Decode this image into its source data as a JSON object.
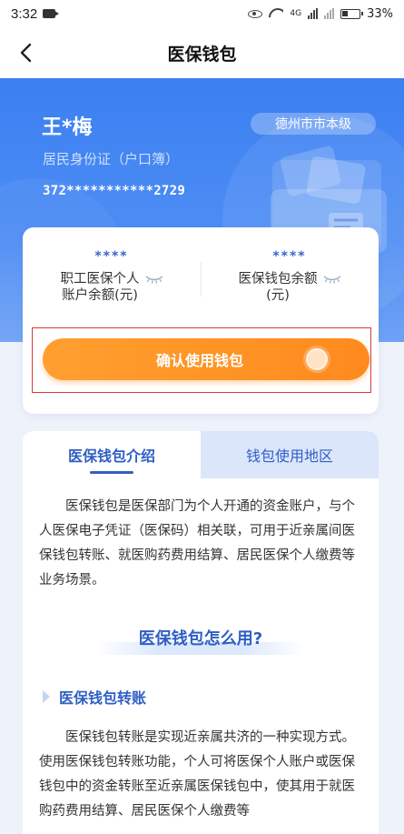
{
  "status_bar": {
    "time": "3:32",
    "network": "4G",
    "battery": "33%"
  },
  "nav": {
    "title": "医保钱包"
  },
  "user": {
    "name": "王*梅",
    "id_type": "居民身份证（户口簿）",
    "id_number": "372***********2729",
    "region": "德州市市本级"
  },
  "balances": {
    "employee": {
      "value": "****",
      "label_line1": "职工医保个人",
      "label_line2": "账户余额(元)"
    },
    "wallet": {
      "value": "****",
      "label_line1": "医保钱包余额",
      "label_line2": "(元)"
    }
  },
  "confirm_button": {
    "label": "确认使用钱包"
  },
  "tabs": [
    {
      "label": "医保钱包介绍",
      "active": true
    },
    {
      "label": "钱包使用地区",
      "active": false
    }
  ],
  "intro": {
    "text": "医保钱包是医保部门为个人开通的资金账户，与个人医保电子凭证（医保码）相关联，可用于近亲属间医保钱包转账、就医购药费用结算、居民医保个人缴费等业务场景。"
  },
  "section": {
    "heading": "医保钱包怎么用?"
  },
  "transfer": {
    "heading": "医保钱包转账",
    "text": "医保钱包转账是实现近亲属共济的一种实现方式。使用医保钱包转账功能，个人可将医保个人账户或医保钱包中的资金转账至近亲属医保钱包中，使其用于就医购药费用结算、居民医保个人缴费等"
  },
  "colors": {
    "primary": "#2f5fc4",
    "hero_blue": "#3b7ff1",
    "orange": "#ff9f2f"
  }
}
